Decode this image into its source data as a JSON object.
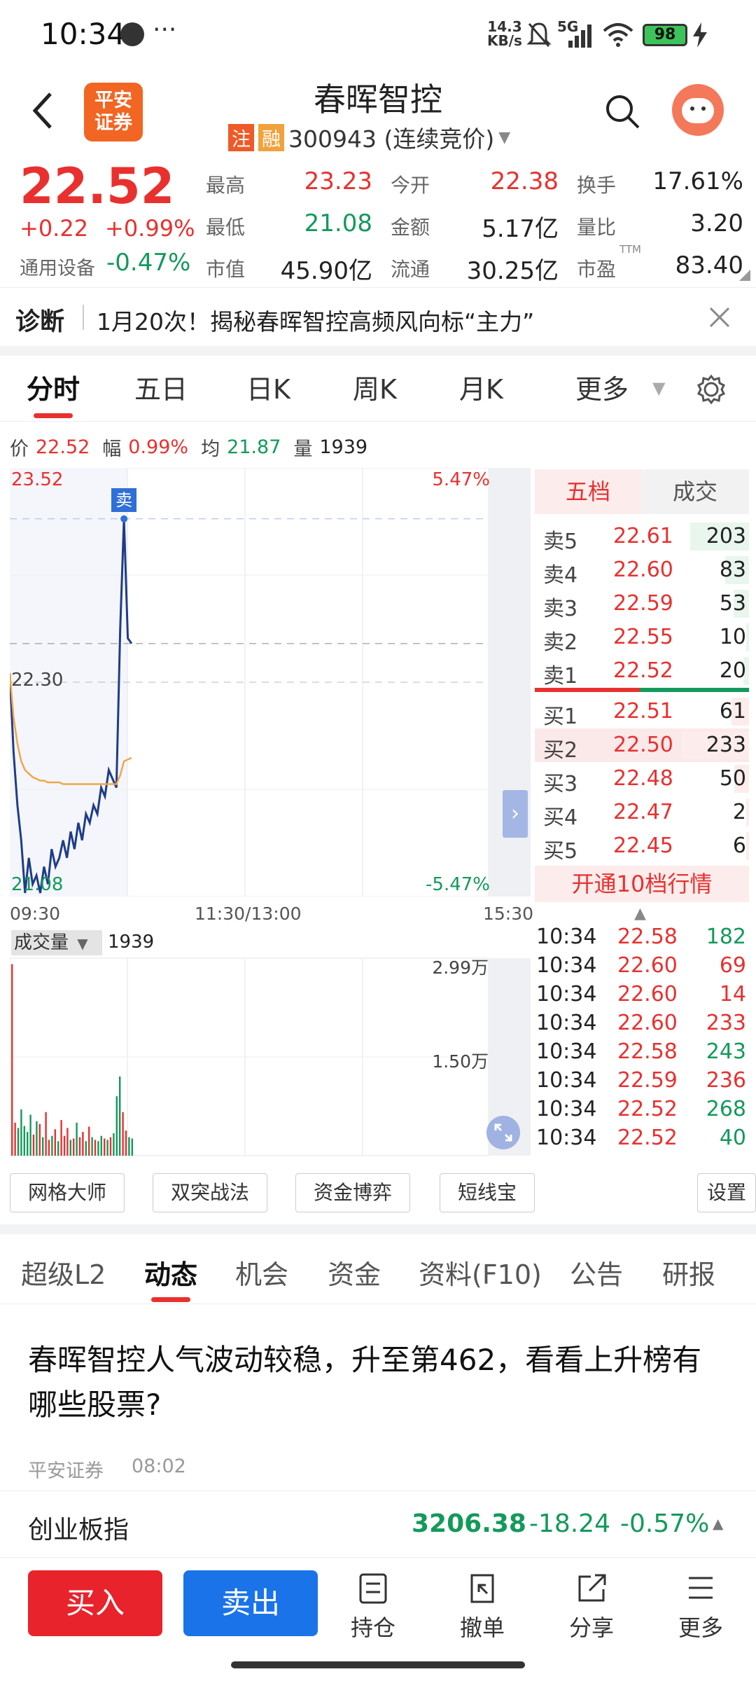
{
  "status": {
    "time": "10:34",
    "dots": "···",
    "net_speed_top": "14.3",
    "net_speed_bot": "KB/s",
    "signal": "5G",
    "battery": "98"
  },
  "header": {
    "logo_line1": "平安",
    "logo_line2": "证券",
    "stock_name": "春晖智控",
    "tag_zhu": "注",
    "tag_rong": "融",
    "code_line": "300943 (连续竞价)"
  },
  "quote": {
    "price": "22.52",
    "change": "+0.22",
    "change_pct": "+0.99%",
    "sector": "通用设备",
    "sector_pct": "-0.47%",
    "stats": [
      {
        "label": "最高",
        "value": "23.23"
      },
      {
        "label": "今开",
        "value": "22.38"
      },
      {
        "label": "换手",
        "value": "17.61%"
      },
      {
        "label": "最低",
        "value": "21.08"
      },
      {
        "label": "金额",
        "value": "5.17亿"
      },
      {
        "label": "量比",
        "value": "3.20"
      },
      {
        "label": "市值",
        "value": "45.90亿"
      },
      {
        "label": "流通",
        "value": "30.25亿"
      },
      {
        "label": "市盈",
        "value": "83.40"
      }
    ],
    "ttm": "TTM"
  },
  "diagnosis": {
    "label": "诊断",
    "text": "1月20次！揭秘春晖智控高频风向标“主力”"
  },
  "chart_tabs": [
    "分时",
    "五日",
    "日K",
    "周K",
    "月K",
    "更多"
  ],
  "chart_info": {
    "price_label": "价",
    "price": "22.52",
    "amp_label": "幅",
    "amp": "0.99%",
    "avg_label": "均",
    "avg": "21.87",
    "vol_label": "量",
    "vol": "1939"
  },
  "chart_data": {
    "type": "line",
    "title": "",
    "price_axis": {
      "top": "23.52",
      "mid": "22.30",
      "bottom": "21.08",
      "top_pct": "5.47%",
      "bottom_pct": "-5.47%"
    },
    "time_axis": [
      "09:30",
      "11:30/13:00",
      "15:30"
    ],
    "sell_marker": "卖",
    "series": [
      {
        "name": "价",
        "values": [
          22.35,
          21.9,
          21.6,
          21.4,
          21.1,
          21.3,
          21.15,
          21.2,
          21.1,
          21.25,
          21.15,
          21.35,
          21.25,
          21.3,
          21.4,
          21.3,
          21.45,
          21.35,
          21.5,
          21.4,
          21.55,
          21.5,
          21.6,
          21.55,
          21.7,
          21.65,
          21.8,
          21.75,
          21.7,
          22.6,
          23.23,
          22.55,
          22.52
        ]
      },
      {
        "name": "均",
        "values": [
          22.35,
          22.1,
          21.95,
          21.85,
          21.8,
          21.78,
          21.76,
          21.75,
          21.74,
          21.74,
          21.73,
          21.73,
          21.73,
          21.73,
          21.72,
          21.72,
          21.72,
          21.72,
          21.72,
          21.72,
          21.72,
          21.72,
          21.72,
          21.72,
          21.72,
          21.72,
          21.72,
          21.72,
          21.72,
          21.77,
          21.85,
          21.86,
          21.87
        ]
      }
    ],
    "volume": {
      "label": "成交量",
      "value": "1939",
      "ytop": "2.99万",
      "ymid": "1.50万",
      "bars": [
        29000,
        5000,
        4200,
        7000,
        4500,
        3600,
        6200,
        3200,
        5200,
        4800,
        2800,
        6600,
        2400,
        3000,
        4000,
        2200,
        5400,
        3000,
        4200,
        2400,
        2600,
        5000,
        2800,
        3600,
        2200,
        4400,
        2800,
        2400,
        2200,
        3000,
        2600,
        2400,
        2800,
        3400,
        9000,
        12000,
        6600,
        3800,
        2800,
        2600
      ]
    }
  },
  "orderbook": {
    "tabs": [
      "五档",
      "成交"
    ],
    "sells": [
      {
        "label": "卖5",
        "price": "22.61",
        "vol": "203"
      },
      {
        "label": "卖4",
        "price": "22.60",
        "vol": "83"
      },
      {
        "label": "卖3",
        "price": "22.59",
        "vol": "53"
      },
      {
        "label": "卖2",
        "price": "22.55",
        "vol": "10"
      },
      {
        "label": "卖1",
        "price": "22.52",
        "vol": "20"
      }
    ],
    "buys": [
      {
        "label": "买1",
        "price": "22.51",
        "vol": "61"
      },
      {
        "label": "买2",
        "price": "22.50",
        "vol": "233"
      },
      {
        "label": "买3",
        "price": "22.48",
        "vol": "50"
      },
      {
        "label": "买4",
        "price": "22.47",
        "vol": "2"
      },
      {
        "label": "买5",
        "price": "22.45",
        "vol": "6"
      }
    ],
    "open10": "开通10档行情"
  },
  "ticks": [
    {
      "time": "10:34",
      "price": "22.58",
      "vol": "182",
      "color": "green"
    },
    {
      "time": "10:34",
      "price": "22.60",
      "vol": "69",
      "color": "red"
    },
    {
      "time": "10:34",
      "price": "22.60",
      "vol": "14",
      "color": "red"
    },
    {
      "time": "10:34",
      "price": "22.60",
      "vol": "233",
      "color": "red"
    },
    {
      "time": "10:34",
      "price": "22.58",
      "vol": "243",
      "color": "green"
    },
    {
      "time": "10:34",
      "price": "22.59",
      "vol": "236",
      "color": "red"
    },
    {
      "time": "10:34",
      "price": "22.52",
      "vol": "268",
      "color": "green"
    },
    {
      "time": "10:34",
      "price": "22.52",
      "vol": "40",
      "color": "green"
    }
  ],
  "tools": [
    "网格大师",
    "双突战法",
    "资金博弈",
    "短线宝",
    "设置"
  ],
  "info_tabs": [
    "超级L2",
    "动态",
    "机会",
    "资金",
    "资料(F10)",
    "公告",
    "研报"
  ],
  "news": {
    "title": "春晖智控人气波动较稳，升至第462，看看上升榜有哪些股票?",
    "source": "平安证券",
    "time": "08:02"
  },
  "index": {
    "name": "创业板指",
    "value": "3206.38",
    "change": "-18.24",
    "pct": "-0.57%"
  },
  "bottom": {
    "buy": "买入",
    "sell": "卖出",
    "nav": [
      "持仓",
      "撤单",
      "分享",
      "更多"
    ]
  },
  "colors": {
    "up": "#e8312f",
    "down": "#139a5b",
    "buy": "#e8312f",
    "sell": "#1a73e8",
    "accent": "#f26522"
  }
}
